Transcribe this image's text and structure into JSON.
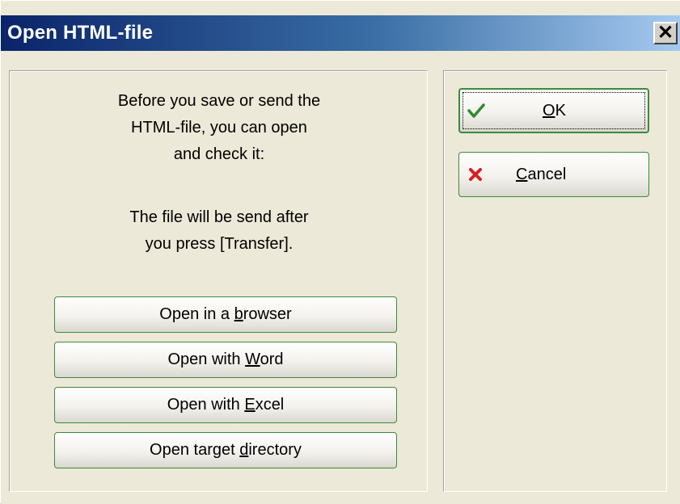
{
  "window": {
    "title": "Open HTML-file",
    "close_glyph": "✕"
  },
  "info": {
    "line1": "Before you save or send the",
    "line2": "HTML-file, you can open",
    "line3": "and check it:",
    "line4": "The file will be send after",
    "line5": "you press [Transfer]."
  },
  "buttons": {
    "browser": {
      "pre": "Open in a ",
      "key": "b",
      "post": "rowser"
    },
    "word": {
      "pre": "Open with ",
      "key": "W",
      "post": "ord"
    },
    "excel": {
      "pre": "Open with ",
      "key": "E",
      "post": "xcel"
    },
    "directory": {
      "pre": "Open target ",
      "key": "d",
      "post": "irectory"
    },
    "ok": {
      "key": "O",
      "post": "K",
      "icon": "checkmark-icon"
    },
    "cancel": {
      "key": "C",
      "post": "ancel",
      "icon": "cross-icon"
    }
  },
  "colors": {
    "title_bar_start": "#0a246a",
    "title_bar_end": "#a6caf0",
    "button_border": "#3c8a3c",
    "checkmark": "#2e8b2e",
    "cross": "#d42020"
  }
}
